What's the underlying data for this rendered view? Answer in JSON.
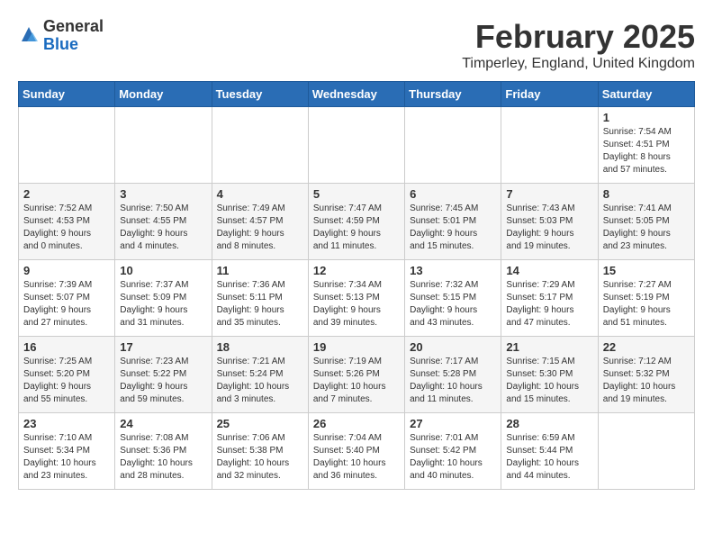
{
  "logo": {
    "general": "General",
    "blue": "Blue"
  },
  "header": {
    "title": "February 2025",
    "subtitle": "Timperley, England, United Kingdom"
  },
  "weekdays": [
    "Sunday",
    "Monday",
    "Tuesday",
    "Wednesday",
    "Thursday",
    "Friday",
    "Saturday"
  ],
  "weeks": [
    [
      {
        "day": "",
        "info": ""
      },
      {
        "day": "",
        "info": ""
      },
      {
        "day": "",
        "info": ""
      },
      {
        "day": "",
        "info": ""
      },
      {
        "day": "",
        "info": ""
      },
      {
        "day": "",
        "info": ""
      },
      {
        "day": "1",
        "info": "Sunrise: 7:54 AM\nSunset: 4:51 PM\nDaylight: 8 hours\nand 57 minutes."
      }
    ],
    [
      {
        "day": "2",
        "info": "Sunrise: 7:52 AM\nSunset: 4:53 PM\nDaylight: 9 hours\nand 0 minutes."
      },
      {
        "day": "3",
        "info": "Sunrise: 7:50 AM\nSunset: 4:55 PM\nDaylight: 9 hours\nand 4 minutes."
      },
      {
        "day": "4",
        "info": "Sunrise: 7:49 AM\nSunset: 4:57 PM\nDaylight: 9 hours\nand 8 minutes."
      },
      {
        "day": "5",
        "info": "Sunrise: 7:47 AM\nSunset: 4:59 PM\nDaylight: 9 hours\nand 11 minutes."
      },
      {
        "day": "6",
        "info": "Sunrise: 7:45 AM\nSunset: 5:01 PM\nDaylight: 9 hours\nand 15 minutes."
      },
      {
        "day": "7",
        "info": "Sunrise: 7:43 AM\nSunset: 5:03 PM\nDaylight: 9 hours\nand 19 minutes."
      },
      {
        "day": "8",
        "info": "Sunrise: 7:41 AM\nSunset: 5:05 PM\nDaylight: 9 hours\nand 23 minutes."
      }
    ],
    [
      {
        "day": "9",
        "info": "Sunrise: 7:39 AM\nSunset: 5:07 PM\nDaylight: 9 hours\nand 27 minutes."
      },
      {
        "day": "10",
        "info": "Sunrise: 7:37 AM\nSunset: 5:09 PM\nDaylight: 9 hours\nand 31 minutes."
      },
      {
        "day": "11",
        "info": "Sunrise: 7:36 AM\nSunset: 5:11 PM\nDaylight: 9 hours\nand 35 minutes."
      },
      {
        "day": "12",
        "info": "Sunrise: 7:34 AM\nSunset: 5:13 PM\nDaylight: 9 hours\nand 39 minutes."
      },
      {
        "day": "13",
        "info": "Sunrise: 7:32 AM\nSunset: 5:15 PM\nDaylight: 9 hours\nand 43 minutes."
      },
      {
        "day": "14",
        "info": "Sunrise: 7:29 AM\nSunset: 5:17 PM\nDaylight: 9 hours\nand 47 minutes."
      },
      {
        "day": "15",
        "info": "Sunrise: 7:27 AM\nSunset: 5:19 PM\nDaylight: 9 hours\nand 51 minutes."
      }
    ],
    [
      {
        "day": "16",
        "info": "Sunrise: 7:25 AM\nSunset: 5:20 PM\nDaylight: 9 hours\nand 55 minutes."
      },
      {
        "day": "17",
        "info": "Sunrise: 7:23 AM\nSunset: 5:22 PM\nDaylight: 9 hours\nand 59 minutes."
      },
      {
        "day": "18",
        "info": "Sunrise: 7:21 AM\nSunset: 5:24 PM\nDaylight: 10 hours\nand 3 minutes."
      },
      {
        "day": "19",
        "info": "Sunrise: 7:19 AM\nSunset: 5:26 PM\nDaylight: 10 hours\nand 7 minutes."
      },
      {
        "day": "20",
        "info": "Sunrise: 7:17 AM\nSunset: 5:28 PM\nDaylight: 10 hours\nand 11 minutes."
      },
      {
        "day": "21",
        "info": "Sunrise: 7:15 AM\nSunset: 5:30 PM\nDaylight: 10 hours\nand 15 minutes."
      },
      {
        "day": "22",
        "info": "Sunrise: 7:12 AM\nSunset: 5:32 PM\nDaylight: 10 hours\nand 19 minutes."
      }
    ],
    [
      {
        "day": "23",
        "info": "Sunrise: 7:10 AM\nSunset: 5:34 PM\nDaylight: 10 hours\nand 23 minutes."
      },
      {
        "day": "24",
        "info": "Sunrise: 7:08 AM\nSunset: 5:36 PM\nDaylight: 10 hours\nand 28 minutes."
      },
      {
        "day": "25",
        "info": "Sunrise: 7:06 AM\nSunset: 5:38 PM\nDaylight: 10 hours\nand 32 minutes."
      },
      {
        "day": "26",
        "info": "Sunrise: 7:04 AM\nSunset: 5:40 PM\nDaylight: 10 hours\nand 36 minutes."
      },
      {
        "day": "27",
        "info": "Sunrise: 7:01 AM\nSunset: 5:42 PM\nDaylight: 10 hours\nand 40 minutes."
      },
      {
        "day": "28",
        "info": "Sunrise: 6:59 AM\nSunset: 5:44 PM\nDaylight: 10 hours\nand 44 minutes."
      },
      {
        "day": "",
        "info": ""
      }
    ]
  ]
}
